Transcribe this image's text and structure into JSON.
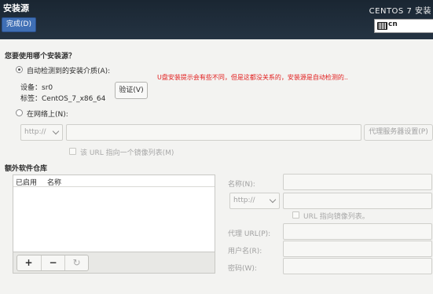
{
  "header": {
    "title": "安装源",
    "done_label": "完成(D)",
    "product": "CENTOS 7 安装",
    "keyboard_layout": "cn"
  },
  "source": {
    "question": "您要使用哪个安装源？",
    "auto_label": "自动检测到的安装介质(A):",
    "auto_selected": true,
    "device": "设备：sr0",
    "tag": "标签：CentOS_7_x86_64",
    "verify_label": "验证(V)",
    "annotation": "U盘安装提示会有些不同，但是这都没关系的，安装源是自动检测的..",
    "network_label": "在网络上(N):",
    "protocol": "http://",
    "url_value": "",
    "proxy_button": "代理服务器设置(P)",
    "mirror_label": "该 URL 指向一个镜像列表(M)"
  },
  "repos": {
    "heading": "额外软件仓库",
    "col_enabled": "已启用",
    "col_name": "名称",
    "add_label": "+",
    "remove_label": "−",
    "reset_label": "↻",
    "name_label": "名称(N):",
    "protocol": "http://",
    "mirror_label": "URL 指向镜像列表。",
    "proxy_url_label": "代理 URL(P):",
    "user_label": "用户名(R):",
    "password_label": "密码(W):"
  },
  "colors": {
    "header_bg": "#1f2d3a",
    "accent": "#3f6fb5",
    "annotation": "#e21b1b"
  }
}
